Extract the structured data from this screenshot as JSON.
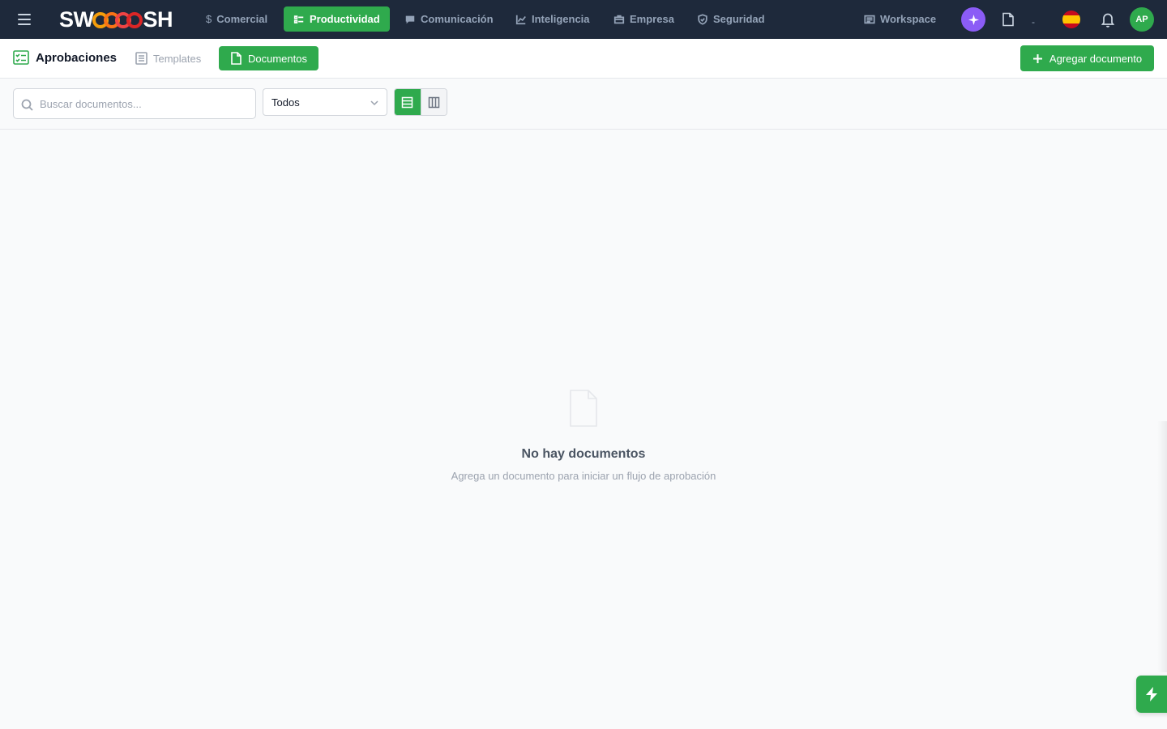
{
  "app": {
    "logo_left": "SW",
    "logo_right": "SH"
  },
  "nav": {
    "items": [
      {
        "label": "Comercial",
        "icon": "dollar-icon"
      },
      {
        "label": "Productividad",
        "icon": "checklist-icon",
        "active": true
      },
      {
        "label": "Comunicación",
        "icon": "chat-icon"
      },
      {
        "label": "Inteligencia",
        "icon": "chart-line-icon"
      },
      {
        "label": "Empresa",
        "icon": "briefcase-icon"
      },
      {
        "label": "Seguridad",
        "icon": "shield-icon"
      }
    ],
    "workspace_label": "Workspace",
    "dot_separator": "-",
    "avatar_initials": "AP",
    "colors": {
      "active": "#2faa4d",
      "ai": "#8b5cf6",
      "nav_bg": "#1e293b"
    }
  },
  "subheader": {
    "title": "Aprobaciones",
    "tabs": [
      {
        "label": "Templates",
        "active": false
      },
      {
        "label": "Documentos",
        "active": true
      }
    ],
    "add_button": "Agregar documento"
  },
  "toolbar": {
    "search_placeholder": "Buscar documentos...",
    "filter_selected": "Todos",
    "view_mode": "list"
  },
  "empty_state": {
    "title": "No hay documentos",
    "subtitle": "Agrega un documento para iniciar un flujo de aprobación"
  }
}
